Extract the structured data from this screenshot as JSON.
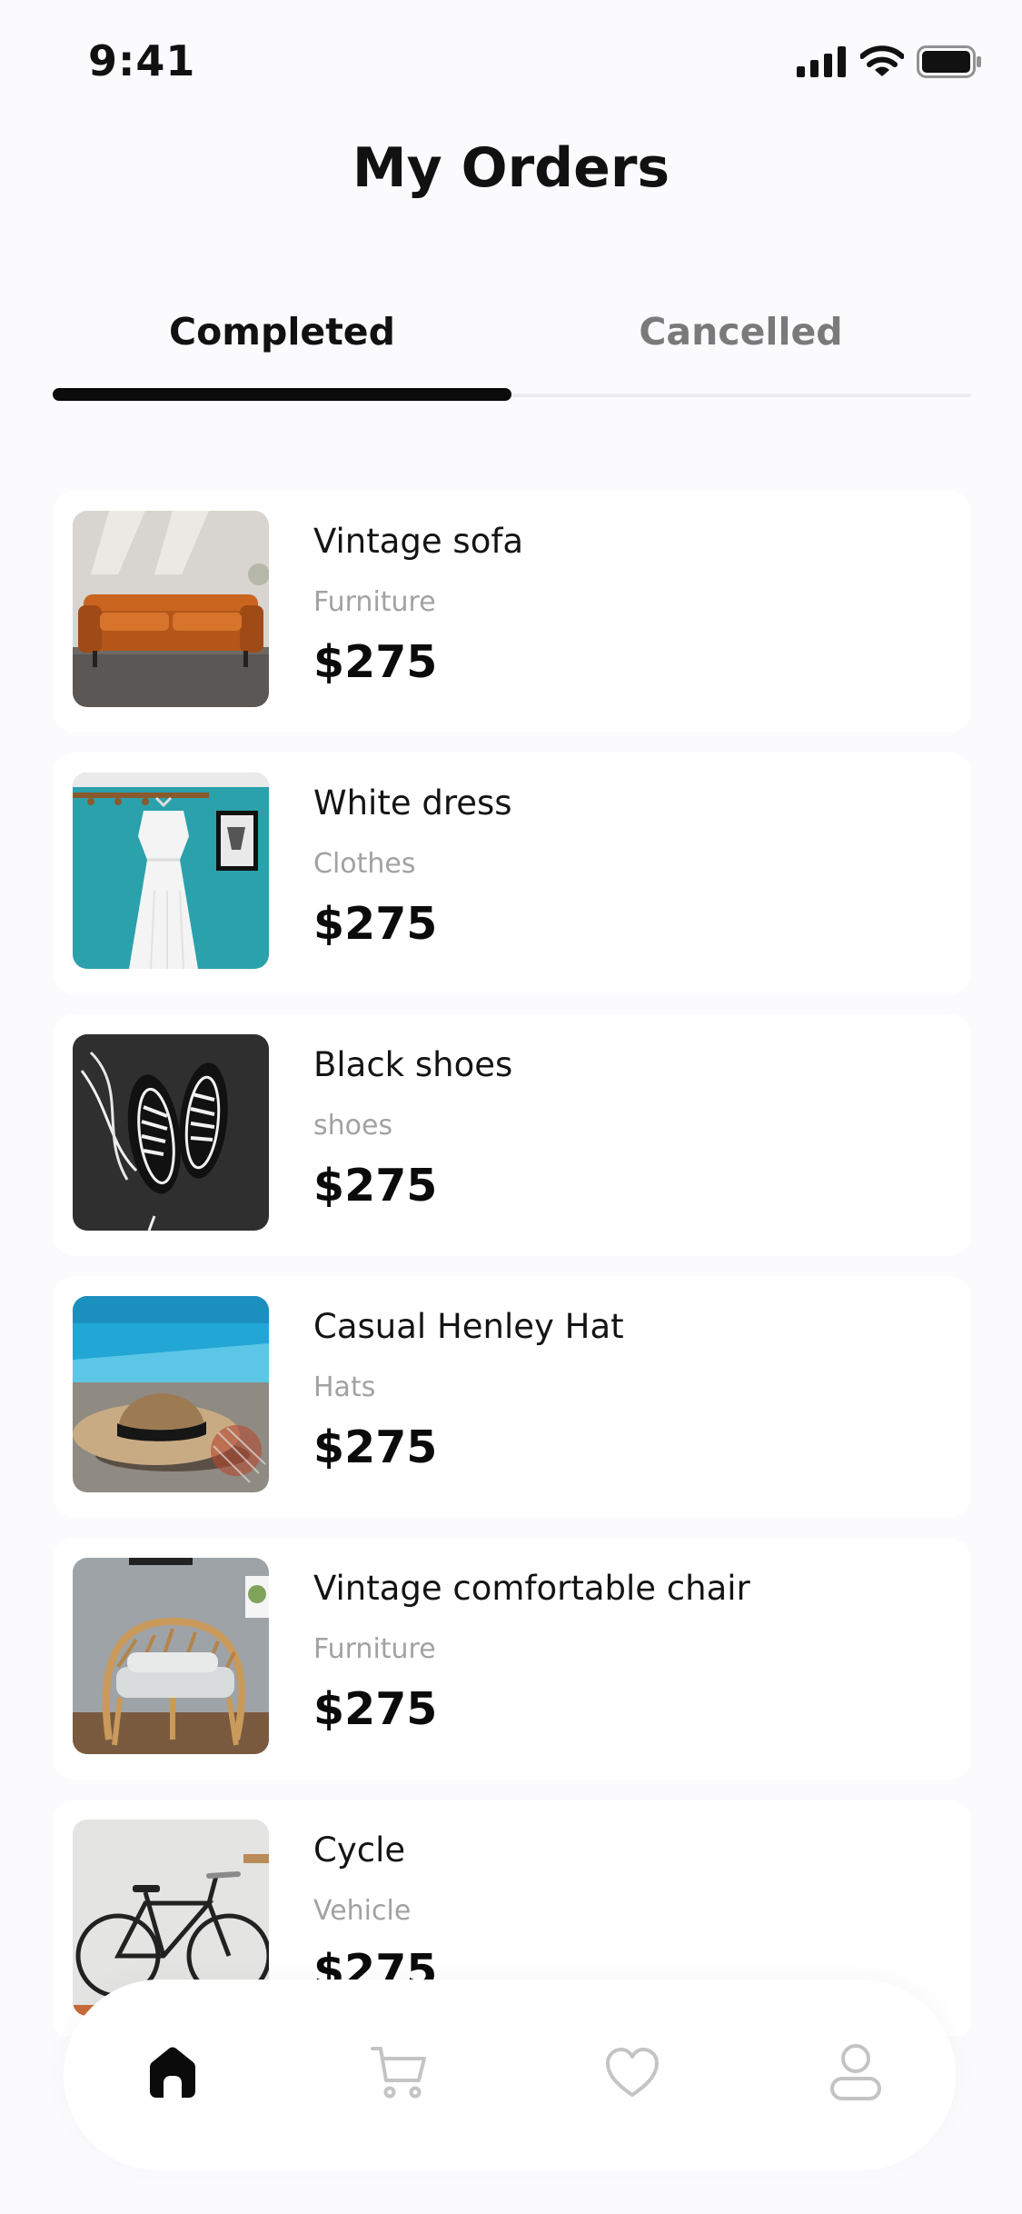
{
  "status_bar": {
    "time": "9:41"
  },
  "header": {
    "title": "My Orders"
  },
  "tabs": [
    {
      "label": "Completed",
      "active": true
    },
    {
      "label": "Cancelled",
      "active": false
    }
  ],
  "orders": [
    {
      "name": "Vintage sofa",
      "category": "Furniture",
      "price": "$275",
      "thumb_icon": "sofa-photo"
    },
    {
      "name": "White dress",
      "category": "Clothes",
      "price": "$275",
      "thumb_icon": "dress-photo"
    },
    {
      "name": "Black shoes",
      "category": "shoes",
      "price": "$275",
      "thumb_icon": "shoes-photo"
    },
    {
      "name": "Casual Henley Hat",
      "category": "Hats",
      "price": "$275",
      "thumb_icon": "hat-photo"
    },
    {
      "name": "Vintage comfortable chair",
      "category": "Furniture",
      "price": "$275",
      "thumb_icon": "chair-photo"
    },
    {
      "name": "Cycle",
      "category": "Vehicle",
      "price": "$275",
      "thumb_icon": "bicycle-photo"
    }
  ],
  "bottom_nav": [
    {
      "icon": "home-icon",
      "active": true
    },
    {
      "icon": "cart-icon",
      "active": false
    },
    {
      "icon": "heart-icon",
      "active": false
    },
    {
      "icon": "profile-icon",
      "active": false
    }
  ],
  "colors": {
    "background": "#fbfbfd",
    "card": "#ffffff",
    "active": "#0b0b0b",
    "inactive_tab": "#7a7a7a",
    "category_text": "#a2a2a2",
    "nav_inactive": "#c4c4c4"
  }
}
